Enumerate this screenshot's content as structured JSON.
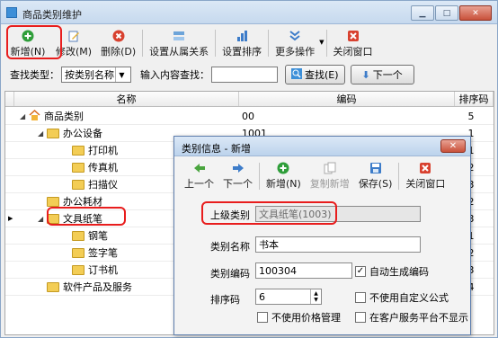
{
  "window": {
    "title": "商品类别维护"
  },
  "toolbar": {
    "add": "新增(N)",
    "edit": "修改(M)",
    "delete": "删除(D)",
    "set_relation": "设置从属关系",
    "set_sort": "设置排序",
    "more": "更多操作",
    "close": "关闭窗口"
  },
  "search": {
    "type_label": "查找类型：",
    "type_value": "按类别名称",
    "content_label": "输入内容查找：",
    "content_value": "",
    "find_button": "查找(E)",
    "next_button": "下一个"
  },
  "grid": {
    "headers": [
      "名称",
      "编码",
      "排序码"
    ],
    "rows": [
      {
        "name": "商品类别",
        "code": "00",
        "sort": "5"
      },
      {
        "name": "办公设备",
        "code": "1001",
        "sort": "1"
      },
      {
        "name": "打印机",
        "code": "",
        "sort": "1"
      },
      {
        "name": "传真机",
        "code": "",
        "sort": "2"
      },
      {
        "name": "扫描仪",
        "code": "",
        "sort": "3"
      },
      {
        "name": "办公耗材",
        "code": "",
        "sort": "2"
      },
      {
        "name": "文具纸笔",
        "code": "",
        "sort": "3"
      },
      {
        "name": "钢笔",
        "code": "",
        "sort": "1"
      },
      {
        "name": "签字笔",
        "code": "",
        "sort": "2"
      },
      {
        "name": "订书机",
        "code": "",
        "sort": "3"
      },
      {
        "name": "软件产品及服务",
        "code": "",
        "sort": "4"
      }
    ]
  },
  "dialog": {
    "title": "类别信息 - 新增",
    "toolbar": {
      "prev": "上一个",
      "next": "下一个",
      "add": "新增(N)",
      "copy_add": "复制新增",
      "save": "保存(S)",
      "close": "关闭窗口"
    },
    "parent_label": "上级类别",
    "parent_value": "文具纸笔(1003)",
    "name_label": "类别名称",
    "name_value": "书本",
    "code_label": "类别编码",
    "code_value": "100304",
    "auto_code": "自动生成编码",
    "sort_label": "排序码",
    "sort_value": "6",
    "no_custom_formula": "不使用自定义公式",
    "no_price_mgmt": "不使用价格管理",
    "no_show_client": "在客户服务平台不显示"
  }
}
